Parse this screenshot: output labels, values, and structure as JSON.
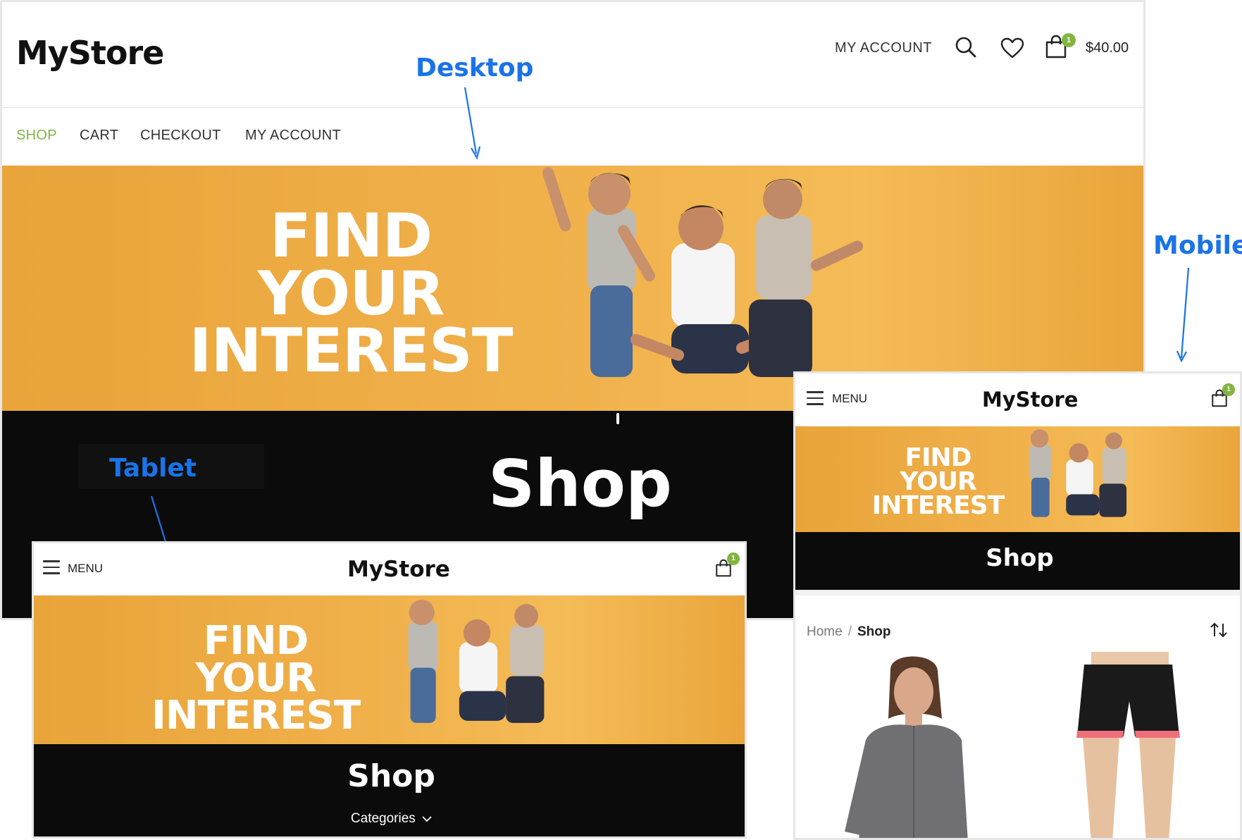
{
  "callouts": {
    "desktop": "Desktop",
    "mobile": "Mobile",
    "tablet": "Tablet"
  },
  "desktop": {
    "logo": "MyStore",
    "my_account": "MY ACCOUNT",
    "cart_count": "1",
    "cart_total": "$40.00",
    "nav": [
      "SHOP",
      "CART",
      "CHECKOUT",
      "MY ACCOUNT"
    ],
    "banner_lines": [
      "FIND",
      "YOUR",
      "INTEREST"
    ],
    "page_title": "Shop"
  },
  "tablet": {
    "menu_label": "MENU",
    "logo": "MyStore",
    "cart_count": "1",
    "banner_lines": [
      "FIND",
      "YOUR",
      "INTEREST"
    ],
    "page_title": "Shop",
    "categories_label": "Categories"
  },
  "mobile": {
    "menu_label": "MENU",
    "logo": "MyStore",
    "cart_count": "1",
    "banner_lines": [
      "FIND",
      "YOUR",
      "INTEREST"
    ],
    "page_title": "Shop",
    "breadcrumb": {
      "home": "Home",
      "separator": "/",
      "current": "Shop"
    }
  },
  "colors": {
    "accent_green": "#82b440",
    "callout_blue": "#1a73e8",
    "banner_orange": "#f0b04a",
    "hero_black": "#0b0b0b"
  },
  "icons": {
    "search": "search-icon",
    "wishlist": "heart-icon",
    "cart": "shopping-bag-icon",
    "menu": "hamburger-menu-icon",
    "sort": "sort-arrows-icon",
    "chevron": "chevron-down-icon"
  }
}
